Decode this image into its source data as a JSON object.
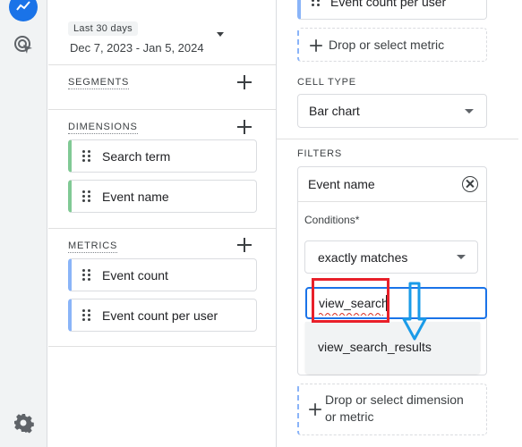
{
  "rail": {
    "top_icon": "analytics-icon",
    "second_icon": "explore-cursor-icon",
    "bottom_icon": "gear-icon"
  },
  "date": {
    "label": "Last 30 days",
    "range": "Dec 7, 2023 - Jan 5, 2024"
  },
  "segments": {
    "title": "SEGMENTS"
  },
  "dimensions": {
    "title": "DIMENSIONS",
    "items": [
      {
        "label": "Search term",
        "color": "#81c995"
      },
      {
        "label": "Event name",
        "color": "#81c995"
      }
    ]
  },
  "metrics": {
    "title": "METRICS",
    "items": [
      {
        "label": "Event count",
        "color": "#8ab4f8"
      },
      {
        "label": "Event count per user",
        "color": "#8ab4f8"
      }
    ]
  },
  "settings": {
    "top_metric": "Event count per user",
    "drop_metric": "Drop or select metric",
    "cell_type_title": "CELL TYPE",
    "cell_type_value": "Bar chart",
    "filters_title": "FILTERS",
    "filter": {
      "field": "Event name",
      "conditions_label": "Conditions*",
      "match_type": "exactly matches",
      "input_value": "view_search",
      "suggestion": "view_search_results"
    },
    "drop_dimension_line1": "Drop or select dimension",
    "drop_dimension_line2": "or metric"
  },
  "colors": {
    "accent": "#1a73e8",
    "annotation_red": "#e8202a",
    "annotation_arrow": "#1a9be8"
  }
}
